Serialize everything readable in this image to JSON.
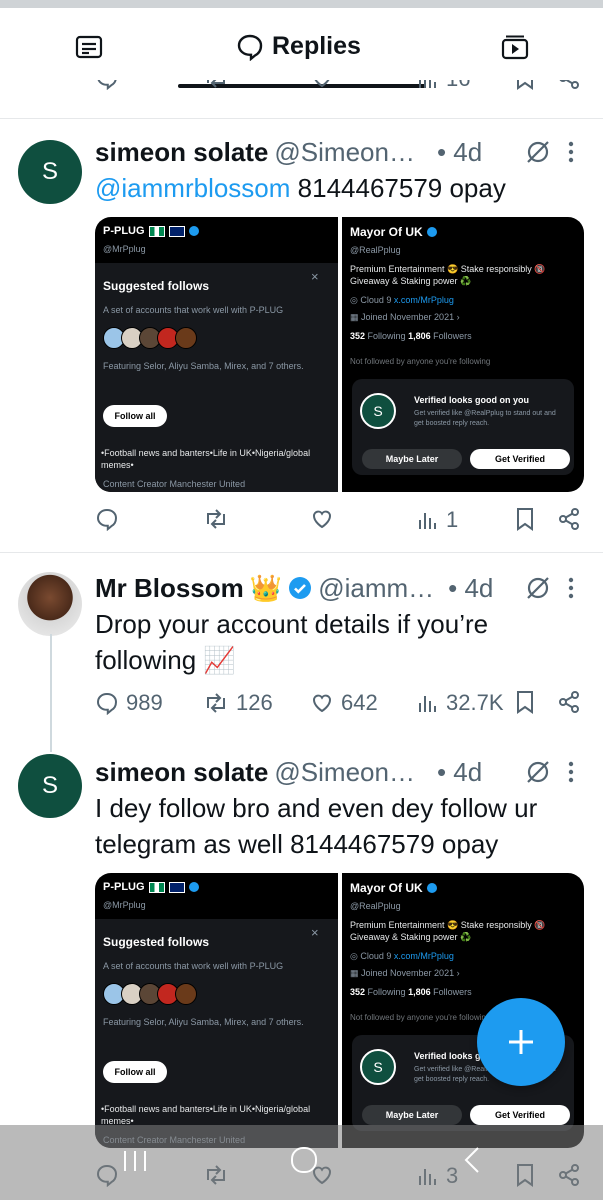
{
  "tabs": {
    "active_label": "Replies",
    "left_icon": "article-icon",
    "right_icon": "video-icon"
  },
  "colors": {
    "accent": "#1d9bf0",
    "text": "#0f1419",
    "secondary": "#536471"
  },
  "top_actions": {
    "views": "16"
  },
  "tweet1": {
    "avatar_letter": "S",
    "name": "simeon solate",
    "handle": "@Simeon…",
    "time": "• 4d",
    "mention": "@iammrblossom",
    "text": " 8144467579 opay",
    "views": "1"
  },
  "tweet2": {
    "name": "Mr Blossom",
    "handle": "@iamm…",
    "time": "• 4d",
    "text": "Drop your account details if you’re following",
    "emoji": "📈",
    "crown": "👑",
    "replies": "989",
    "reposts": "126",
    "likes": "642",
    "views": "32.7K"
  },
  "tweet3": {
    "avatar_letter": "S",
    "name": "simeon solate",
    "handle": "@Simeon…",
    "time": "• 4d",
    "text": "I dey follow bro and even dey follow ur telegram as well 8144467579 opay",
    "views": "3"
  },
  "media": {
    "left": {
      "brand": "P-PLUG",
      "handle": "@MrPplug",
      "suggested_title": "Suggested follows",
      "suggested_desc": "A set of accounts that work well with P-PLUG",
      "featuring": "Featuring Selor, Aliyu Samba, Mirex, and 7 others.",
      "follow_all": "Follow all",
      "bio": "•Football news and banters•Life in UK•Nigeria/global memes•",
      "meta": "Content Creator  Manchester United"
    },
    "right": {
      "name": "Mayor Of UK",
      "handle": "@RealPplug",
      "bio": "Premium Entertainment 😎 Stake responsibly 🔞 Giveaway & Staking power ♻️",
      "location": "Cloud 9",
      "link": "x.com/MrPplug",
      "joined": "Joined November 2021",
      "following_count": "352",
      "following_label": "Following",
      "followers_count": "1,806",
      "followers_label": "Followers",
      "not_followed": "Not followed by anyone you're following",
      "verified_title": "Verified looks good on you",
      "verified_desc": "Get verified like @RealPplug to stand out and get boosted reply reach.",
      "maybe_later": "Maybe Later",
      "get_verified": "Get Verified",
      "avatar_letter": "S"
    }
  }
}
